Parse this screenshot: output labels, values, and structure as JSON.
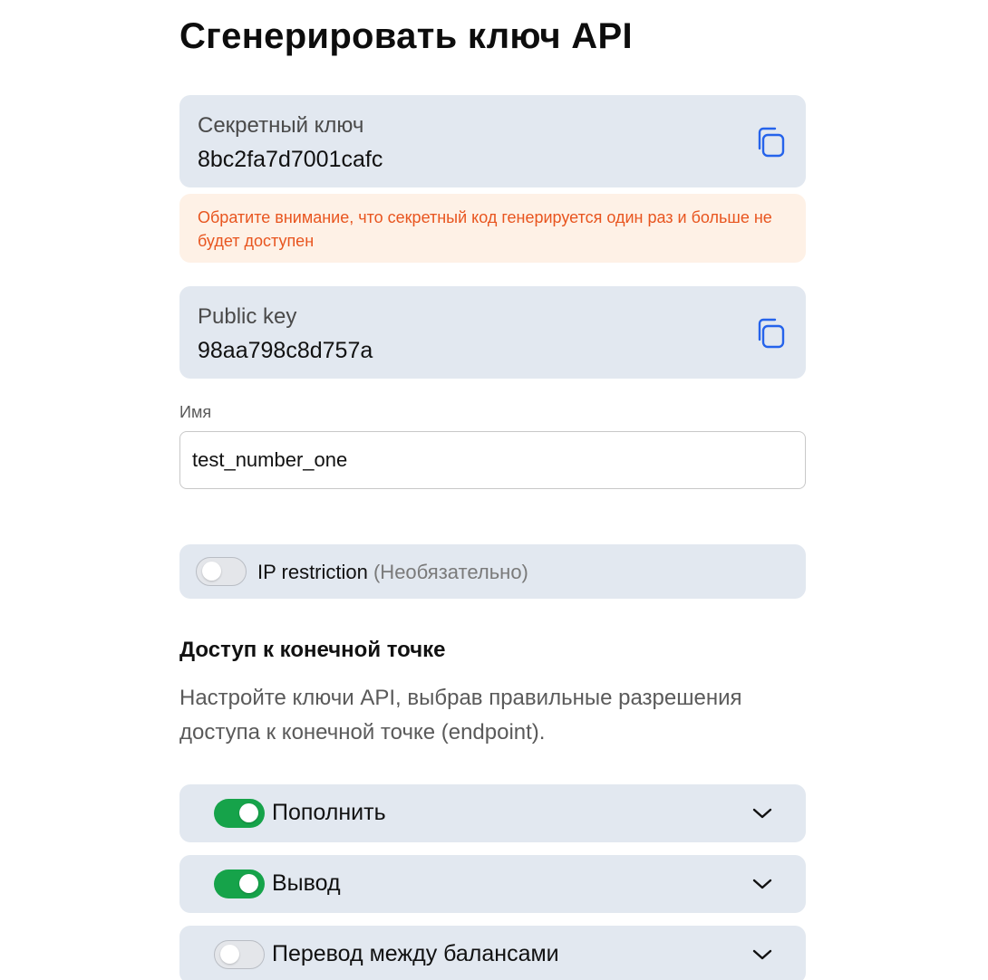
{
  "page": {
    "title": "Сгенерировать ключ API"
  },
  "secret_key": {
    "label": "Секретный ключ",
    "value": "8bc2fa7d7001cafc",
    "copy_icon": "copy-icon"
  },
  "notice": {
    "text": "Обратите внимание, что секретный код генерируется один раз и больше не будет доступен",
    "color": "#e8551f"
  },
  "public_key": {
    "label": "Public key",
    "value": "98aa798c8d757a",
    "copy_icon": "copy-icon"
  },
  "name_field": {
    "label": "Имя",
    "value": "test_number_one"
  },
  "ip_restriction": {
    "label": "IP restriction",
    "optional_text": "(Необязательно)",
    "enabled": false
  },
  "endpoint_access": {
    "title": "Доступ к конечной точке",
    "description": "Настройте ключи API, выбрав правильные разрешения доступа к конечной точке (endpoint).",
    "permissions": [
      {
        "label": "Пополнить",
        "enabled": true
      },
      {
        "label": "Вывод",
        "enabled": true
      },
      {
        "label": "Перевод между балансами",
        "enabled": false
      }
    ]
  },
  "colors": {
    "accent_blue": "#2563eb",
    "toggle_on": "#16a34a",
    "card_bg": "#e2e8f0"
  }
}
